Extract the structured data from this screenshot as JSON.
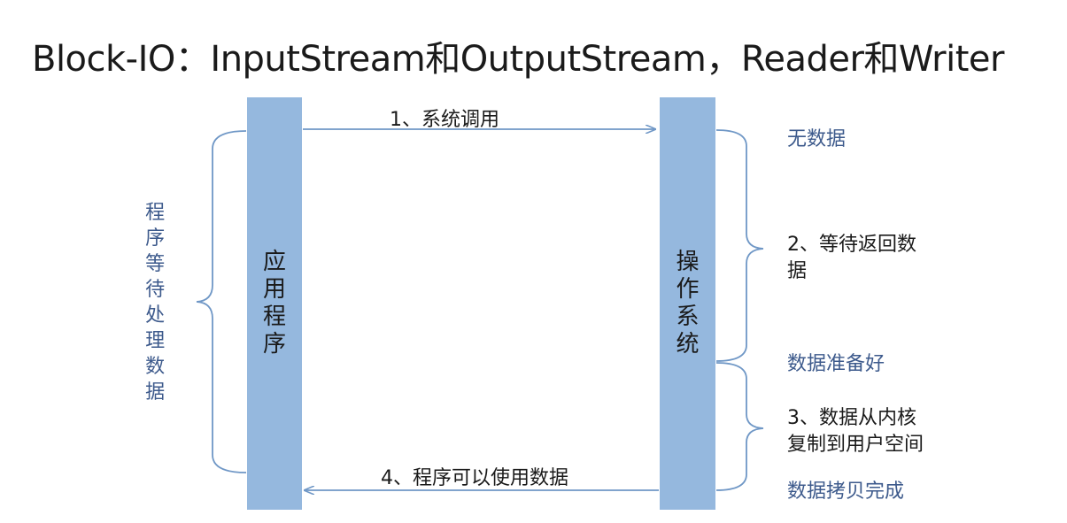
{
  "title": "Block-IO：InputStream和OutputStream，Reader和Writer",
  "app_program": "应用程序",
  "operating_system": "操作系统",
  "program_wait": "程序等待处理数据",
  "step1": "1、系统调用",
  "step4": "4、程序可以使用数据",
  "no_data": "无数据",
  "step2_line1": "2、等待返回数",
  "step2_line2": "据",
  "data_ready": "数据准备好",
  "step3_line1": "3、数据从内核",
  "step3_line2": "复制到用户空间",
  "copy_done": "数据拷贝完成",
  "colors": {
    "bar": "#95b8de",
    "line": "#6f97c6",
    "label_blue": "#3d5a8c"
  }
}
